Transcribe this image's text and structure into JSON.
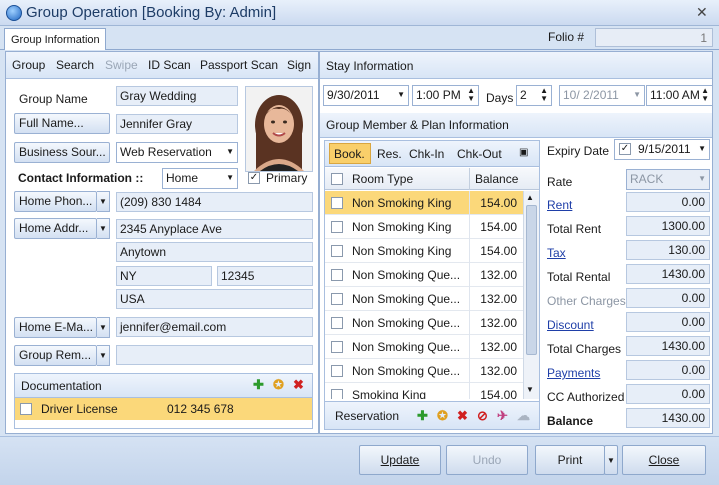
{
  "window": {
    "title": "Group Operation [Booking By: Admin]"
  },
  "tabs": [
    {
      "label": "Group Information"
    }
  ],
  "folio": {
    "label": "Folio #",
    "value": "1"
  },
  "left_toolbar": {
    "items": [
      "Group",
      "Search",
      "Swipe",
      "ID Scan",
      "Passport Scan",
      "Sign"
    ],
    "disabled": [
      "Swipe"
    ]
  },
  "group": {
    "group_name_label": "Group Name",
    "group_name": "Gray Wedding",
    "full_name_label": "Full Name...",
    "full_name": "Jennifer Gray",
    "business_source_label": "Business Sour...",
    "business_source": "Web Reservation",
    "contact_label": "Contact Information ::",
    "contact_type": "Home",
    "primary_label": "Primary",
    "primary_checked": true,
    "phone_label": "Home Phon...",
    "phone": "(209) 830 1484",
    "address_label": "Home Addr...",
    "address1": "2345 Anyplace Ave",
    "city": "Anytown",
    "state": "NY",
    "zip": "12345",
    "country": "USA",
    "email_label": "Home E-Ma...",
    "email": "jennifer@email.com",
    "remarks_label": "Group Rem...",
    "remarks": ""
  },
  "documentation": {
    "title": "Documentation",
    "rows": [
      {
        "type": "Driver License",
        "number": "012 345 678"
      }
    ]
  },
  "stay": {
    "title": "Stay Information",
    "arrival_date": "9/30/2011",
    "arrival_time": "1:00 PM",
    "days_label": "Days",
    "days": "2",
    "departure_date": "10/  2/2011",
    "departure_time": "11:00 AM"
  },
  "members": {
    "title": "Group Member & Plan Information",
    "tabs": [
      "Book.",
      "Res.",
      "Chk-In",
      "Chk-Out"
    ],
    "active_tab": "Book.",
    "columns": [
      "Room Type",
      "Balance"
    ],
    "rows": [
      {
        "room": "Non Smoking King",
        "balance": "154.00",
        "selected": true
      },
      {
        "room": "Non Smoking King",
        "balance": "154.00"
      },
      {
        "room": "Non Smoking King",
        "balance": "154.00"
      },
      {
        "room": "Non Smoking Que...",
        "balance": "132.00"
      },
      {
        "room": "Non Smoking Que...",
        "balance": "132.00"
      },
      {
        "room": "Non Smoking Que...",
        "balance": "132.00"
      },
      {
        "room": "Non Smoking Que...",
        "balance": "132.00"
      },
      {
        "room": "Non Smoking Que...",
        "balance": "132.00"
      },
      {
        "room": "Smoking King",
        "balance": "154.00"
      }
    ],
    "footer_label": "Reservation"
  },
  "summary": {
    "expiry_label": "Expiry Date",
    "expiry_checked": true,
    "expiry_date": "9/15/2011",
    "rate_label": "Rate",
    "rate_value": "RACK",
    "rows": [
      {
        "label": "Rent",
        "value": "0.00",
        "style": "link"
      },
      {
        "label": "Total Rent",
        "value": "1300.00",
        "style": "plain"
      },
      {
        "label": "Tax",
        "value": "130.00",
        "style": "link"
      },
      {
        "label": "Total Rental",
        "value": "1430.00",
        "style": "plain"
      },
      {
        "label": "Other Charges",
        "value": "0.00",
        "style": "muted"
      },
      {
        "label": "Discount",
        "value": "0.00",
        "style": "link"
      },
      {
        "label": "Total Charges",
        "value": "1430.00",
        "style": "plain"
      },
      {
        "label": "Payments",
        "value": "0.00",
        "style": "link"
      },
      {
        "label": "CC Authorized",
        "value": "0.00",
        "style": "plain"
      },
      {
        "label": "Balance",
        "value": "1430.00",
        "style": "bold"
      }
    ]
  },
  "buttons": {
    "update": "Update",
    "undo": "Undo",
    "print": "Print",
    "close": "Close"
  },
  "colors": {
    "accent": "#1f3fa8",
    "selection": "#fbd87a",
    "active_tab": "#f9cf6a",
    "panel_border": "#97afd2"
  }
}
